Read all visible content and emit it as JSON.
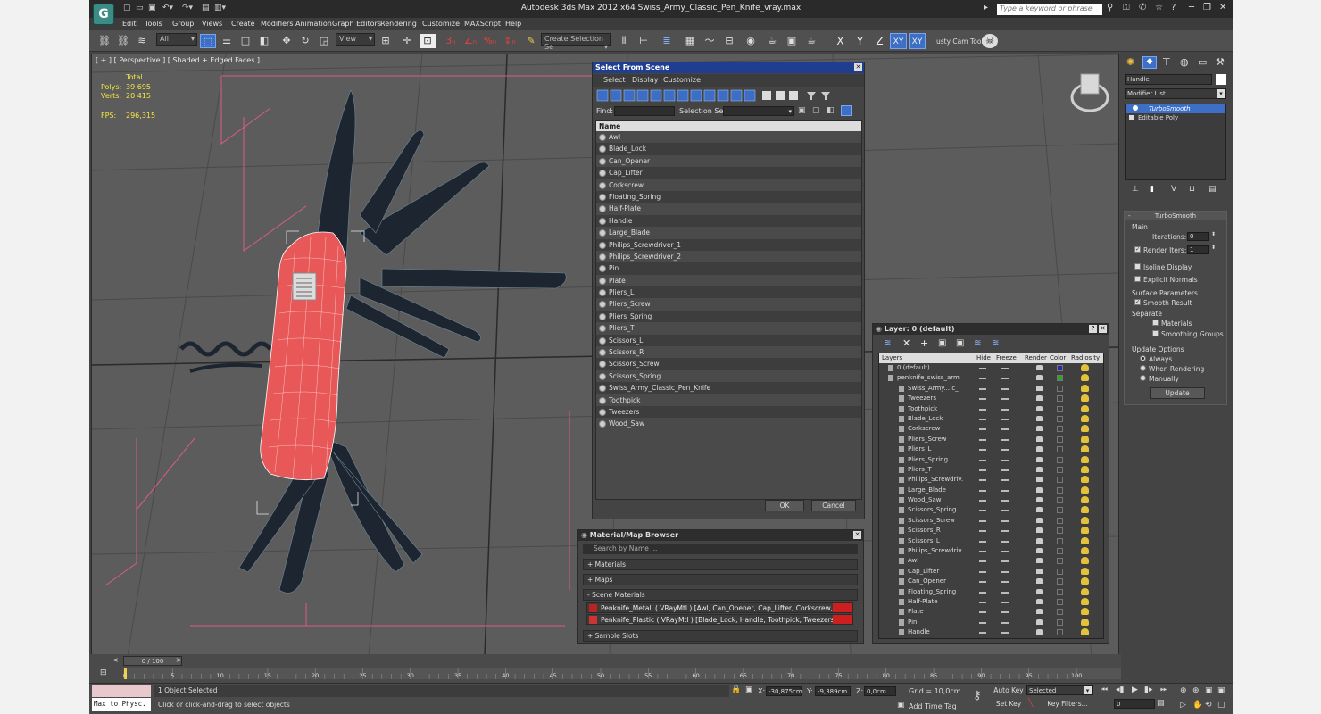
{
  "window": {
    "title": "Autodesk 3ds Max  2012 x64     Swiss_Army_Classic_Pen_Knife_vray.max",
    "search_placeholder": "Type a keyword or phrase"
  },
  "menu": [
    "Edit",
    "Tools",
    "Group",
    "Views",
    "Create",
    "Modifiers",
    "Animation",
    "Graph Editors",
    "Rendering",
    "Customize",
    "MAXScript",
    "Help"
  ],
  "toolbar": {
    "filter_value": "All",
    "refcoord_value": "View",
    "selection_set_value": "Create Selection Se",
    "axis": [
      "X",
      "Y",
      "Z",
      "XY",
      "XY"
    ],
    "custom_label": "usty Cam Tool v"
  },
  "viewport": {
    "label": "[ + ] [ Perspective ] [ Shaded + Edged Faces ]",
    "stats": {
      "total_label": "Total",
      "polys_label": "Polys:",
      "polys": "39 695",
      "verts_label": "Verts:",
      "verts": "20 415",
      "fps_label": "FPS:",
      "fps": "296,315"
    }
  },
  "select_from_scene": {
    "title": "Select From Scene",
    "menu": [
      "Select",
      "Display",
      "Customize"
    ],
    "find_label": "Find:",
    "selset_label": "Selection Set:",
    "column": "Name",
    "items": [
      "Awl",
      "Blade_Lock",
      "Can_Opener",
      "Cap_Lifter",
      "Corkscrew",
      "Floating_Spring",
      "Half-Plate",
      "Handle",
      "Large_Blade",
      "Philips_Screwdriver_1",
      "Philips_Screwdriver_2",
      "Pin",
      "Plate",
      "Pliers_L",
      "Pliers_Screw",
      "Pliers_Spring",
      "Pliers_T",
      "Scissors_L",
      "Scissors_R",
      "Scissors_Screw",
      "Scissors_Spring",
      "Swiss_Army_Classic_Pen_Knife",
      "Toothpick",
      "Tweezers",
      "Wood_Saw"
    ],
    "ok": "OK",
    "cancel": "Cancel"
  },
  "material_browser": {
    "title": "Material/Map Browser",
    "search_placeholder": "Search by Name ...",
    "groups": [
      "+ Materials",
      "+ Maps",
      "- Scene Materials",
      "+ Sample Slots"
    ],
    "materials": [
      "Penknife_Metall  ( VRayMtl ) [Awl, Can_Opener, Cap_Lifter, Corkscrew, Floating...",
      "Penknife_Plastic  ( VRayMtl ) [Blade_Lock, Handle, Toothpick, Tweezers]"
    ]
  },
  "layer_manager": {
    "title": "Layer: 0 (default)",
    "columns": [
      "Layers",
      "Hide",
      "Freeze",
      "Render",
      "Color",
      "Radiosity"
    ],
    "rows": [
      {
        "name": "0 (default)",
        "indent": 0,
        "color": "#2a2aa0"
      },
      {
        "name": "penknife_swiss_arm",
        "indent": 0,
        "color": "#22aa22"
      },
      {
        "name": "Swiss_Army....c_",
        "indent": 1
      },
      {
        "name": "Tweezers",
        "indent": 1
      },
      {
        "name": "Toothpick",
        "indent": 1
      },
      {
        "name": "Blade_Lock",
        "indent": 1
      },
      {
        "name": "Corkscrew",
        "indent": 1
      },
      {
        "name": "Pliers_Screw",
        "indent": 1
      },
      {
        "name": "Pliers_L",
        "indent": 1
      },
      {
        "name": "Pliers_Spring",
        "indent": 1
      },
      {
        "name": "Pliers_T",
        "indent": 1
      },
      {
        "name": "Philips_Screwdriv.",
        "indent": 1
      },
      {
        "name": "Large_Blade",
        "indent": 1
      },
      {
        "name": "Wood_Saw",
        "indent": 1
      },
      {
        "name": "Scissors_Spring",
        "indent": 1
      },
      {
        "name": "Scissors_Screw",
        "indent": 1
      },
      {
        "name": "Scissors_R",
        "indent": 1
      },
      {
        "name": "Scissors_L",
        "indent": 1
      },
      {
        "name": "Philips_Screwdriv.",
        "indent": 1
      },
      {
        "name": "Awl",
        "indent": 1
      },
      {
        "name": "Cap_Lifter",
        "indent": 1
      },
      {
        "name": "Can_Opener",
        "indent": 1
      },
      {
        "name": "Floating_Spring",
        "indent": 1
      },
      {
        "name": "Half-Plate",
        "indent": 1
      },
      {
        "name": "Plate",
        "indent": 1
      },
      {
        "name": "Pin",
        "indent": 1
      },
      {
        "name": "Handle",
        "indent": 1
      }
    ]
  },
  "command_panel": {
    "object_name": "Handle",
    "modifier_list": "Modifier List",
    "stack": [
      "TurboSmooth",
      "Editable Poly"
    ],
    "turbosmooth": {
      "title": "TurboSmooth",
      "main": "Main",
      "iterations_label": "Iterations:",
      "iterations": "0",
      "render_iters_label": "Render Iters:",
      "render_iters": "1",
      "isoline": "Isoline Display",
      "explicit": "Explicit Normals",
      "surface": "Surface Parameters",
      "smooth": "Smooth Result",
      "separate": "Separate",
      "materials": "Materials",
      "smoothing": "Smoothing Groups",
      "update_options": "Update Options",
      "always": "Always",
      "when_rendering": "When Rendering",
      "manually": "Manually",
      "update": "Update"
    }
  },
  "timeline": {
    "frame": "0 / 100",
    "ticks": [
      "0",
      "5",
      "10",
      "15",
      "20",
      "25",
      "30",
      "35",
      "40",
      "45",
      "50",
      "55",
      "60",
      "65",
      "70",
      "75",
      "80",
      "85",
      "90",
      "95",
      "100"
    ]
  },
  "status": {
    "script": "Max to Physc.",
    "selected": "1 Object Selected",
    "prompt": "Click or click-and-drag to select objects",
    "x_label": "X:",
    "x": "-30,875cm",
    "y_label": "Y:",
    "y": "-9,389cm",
    "z_label": "Z:",
    "z": "0,0cm",
    "grid": "Grid = 10,0cm",
    "add_time_tag": "Add Time Tag",
    "auto_key": "Auto Key",
    "set_key": "Set Key",
    "selected_dd": "Selected",
    "key_filters": "Key Filters...",
    "frame_field": "0"
  }
}
